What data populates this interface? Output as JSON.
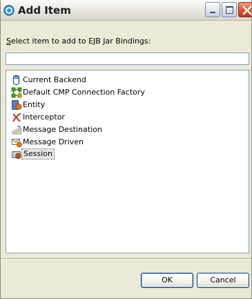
{
  "window": {
    "title": "Add Item",
    "controls": {
      "minimize": "minimize-icon",
      "maximize": "maximize-icon",
      "close": "close-icon"
    }
  },
  "prompt": {
    "mnemonic": "S",
    "rest": "elect item to add to EJB Jar Bindings:"
  },
  "filter": {
    "value": "",
    "placeholder": ""
  },
  "items": [
    {
      "label": "Current Backend",
      "icon": "database-icon"
    },
    {
      "label": "Default CMP Connection Factory",
      "icon": "connection-factory-icon"
    },
    {
      "label": "Entity",
      "icon": "entity-bean-icon"
    },
    {
      "label": "Interceptor",
      "icon": "interceptor-icon"
    },
    {
      "label": "Message Destination",
      "icon": "message-destination-icon"
    },
    {
      "label": "Message Driven",
      "icon": "message-driven-bean-icon"
    },
    {
      "label": "Session",
      "icon": "session-bean-icon",
      "selected": true
    }
  ],
  "buttons": {
    "ok": "OK",
    "cancel": "Cancel"
  },
  "colors": {
    "titlebar": "#ebeae3",
    "dialog": "#ece9d8",
    "input_border": "#7f9db9",
    "close_button": "#e0532e"
  }
}
